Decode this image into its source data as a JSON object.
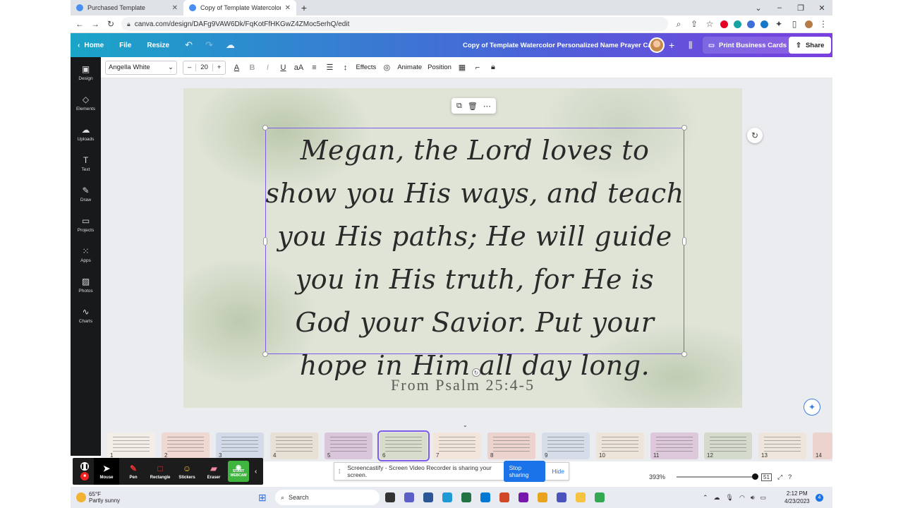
{
  "browser": {
    "tabs": [
      {
        "title": "Purchased Template"
      },
      {
        "title": "Copy of Template Watercolor Pe"
      }
    ],
    "url": "canva.com/design/DAFg9VAW6Dk/FqKotFfHKGwZ4ZMoc5erhQ/edit"
  },
  "canva_header": {
    "home": "Home",
    "file": "File",
    "resize": "Resize",
    "doc_title": "Copy of Template Watercolor Personalized Name Prayer Ca...",
    "print_label": "Print Business Cards",
    "share_label": "Share"
  },
  "sidebar": {
    "items": [
      {
        "label": "Design",
        "icon": "layout-icon"
      },
      {
        "label": "Elements",
        "icon": "shapes-icon"
      },
      {
        "label": "Uploads",
        "icon": "cloud-upload-icon"
      },
      {
        "label": "Text",
        "icon": "text-icon"
      },
      {
        "label": "Draw",
        "icon": "pen-icon"
      },
      {
        "label": "Projects",
        "icon": "folder-icon"
      },
      {
        "label": "Apps",
        "icon": "grid-icon"
      },
      {
        "label": "Photos",
        "icon": "image-icon"
      },
      {
        "label": "Charts",
        "icon": "chart-icon"
      }
    ]
  },
  "toolbar": {
    "font": "Angella White",
    "size": "20",
    "effects": "Effects",
    "animate": "Animate",
    "position": "Position"
  },
  "canvas": {
    "script_text": "Megan, the Lord loves to show you His ways, and teach you His paths; He will guide you in His truth, for He is God your Savior. Put your hope in Him all day long.",
    "reference": "From Psalm 25:4-5"
  },
  "thumbnails": {
    "numbers": [
      "1",
      "2",
      "3",
      "4",
      "5",
      "6",
      "7",
      "8",
      "9",
      "10",
      "11",
      "12",
      "13",
      "14"
    ],
    "selected": "6"
  },
  "screencastify": {
    "tools": [
      "Mouse",
      "Pen",
      "Rectangle",
      "Stickers",
      "Eraser"
    ],
    "webcam": "START WEBCAM",
    "banner": "Screencastify - Screen Video Recorder is sharing your screen.",
    "stop": "Stop sharing",
    "hide": "Hide"
  },
  "zoom": {
    "level": "393%",
    "page_indicator": "51"
  },
  "taskbar": {
    "temp": "65°F",
    "weather": "Partly sunny",
    "search": "Search",
    "time": "2:12 PM",
    "date": "4/23/2023",
    "notifications": "4"
  }
}
